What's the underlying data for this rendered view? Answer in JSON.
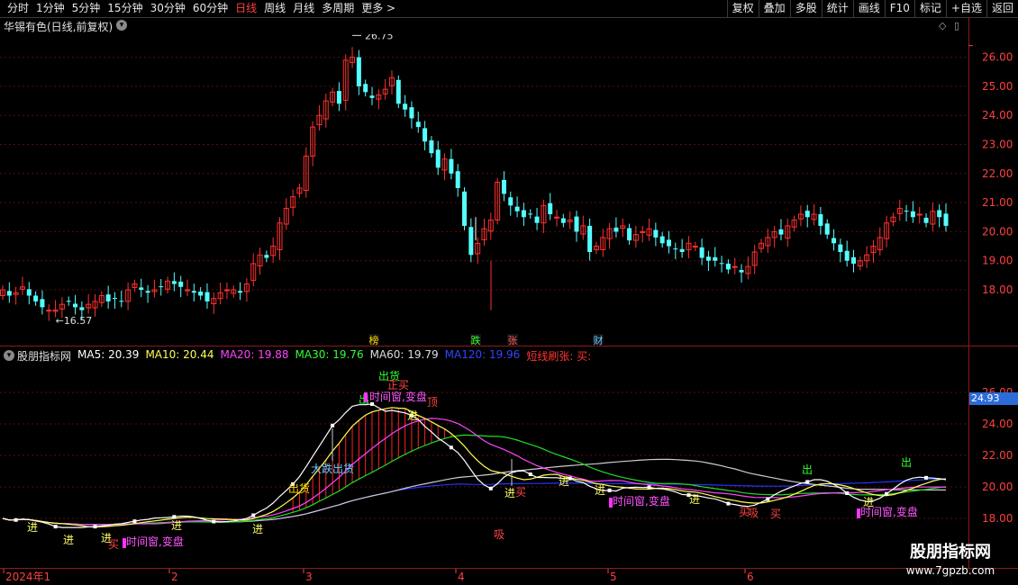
{
  "toolbar": {
    "periods": [
      "分时",
      "1分钟",
      "5分钟",
      "15分钟",
      "30分钟",
      "60分钟",
      "日线",
      "周线",
      "月线",
      "多周期",
      "更多 >"
    ],
    "active_index": 6,
    "right_buttons": [
      "复权",
      "叠加",
      "多股",
      "统计",
      "画线",
      "F10",
      "标记",
      "+自选",
      "返回"
    ]
  },
  "stock_title": "华锡有色(日线,前复权)",
  "main_chart": {
    "price_levels": [
      "26.00",
      "25.00",
      "24.00",
      "23.00",
      "22.00",
      "21.00",
      "20.00",
      "19.00",
      "18.00"
    ],
    "high_label": "26.75",
    "low_label": "16.57",
    "event_tags": [
      {
        "text": "榜",
        "color": "#ffd700"
      },
      {
        "text": "跌",
        "color": "#33ff33"
      },
      {
        "text": "张",
        "color": "#ff6060"
      },
      {
        "text": "财",
        "color": "#66ccff"
      }
    ],
    "up_color": "#ff3030",
    "down_color": "#54ffff"
  },
  "indicator": {
    "name": "股朋指标网",
    "legend": [
      {
        "text": "MA5: 20.39",
        "color": "#ffffff"
      },
      {
        "text": "MA10: 20.44",
        "color": "#ffff55"
      },
      {
        "text": "MA20: 19.88",
        "color": "#ff44ff"
      },
      {
        "text": "MA30: 19.76",
        "color": "#33ff33"
      },
      {
        "text": "MA60: 19.79",
        "color": "#dddddd"
      },
      {
        "text": "MA120: 19.96",
        "color": "#3344ff"
      },
      {
        "text": "短线刷张: 买:",
        "color": "#ff3333"
      }
    ],
    "price_levels": [
      "26.00",
      "24.00",
      "22.00",
      "20.00",
      "18.00"
    ],
    "current_price": "24.93",
    "signals": [
      {
        "text": "出货",
        "color": "#33ff33"
      },
      {
        "text": "正买",
        "color": "#ff4444"
      },
      {
        "text": "出",
        "color": "#33ff33"
      },
      {
        "text": "出",
        "color": "#33ff33"
      },
      {
        "text": "出",
        "color": "#33ff33"
      },
      {
        "text": "时间窗,变盘",
        "color": "#ff55ff"
      },
      {
        "text": "顶",
        "color": "#ff4444"
      },
      {
        "text": "大跌出货",
        "color": "#66ccff"
      },
      {
        "text": "出货",
        "color": "#ffd700"
      },
      {
        "text": "进",
        "color": "#ffff66"
      },
      {
        "text": "进",
        "color": "#ffff66"
      },
      {
        "text": "进",
        "color": "#ffff66"
      },
      {
        "text": "进",
        "color": "#ffff66"
      },
      {
        "text": "进",
        "color": "#ffff66"
      },
      {
        "text": "进",
        "color": "#ffff66"
      },
      {
        "text": "进",
        "color": "#ffff66"
      },
      {
        "text": "进",
        "color": "#ffff66"
      },
      {
        "text": "进",
        "color": "#ffff66"
      },
      {
        "text": "进",
        "color": "#ffff66"
      },
      {
        "text": "进",
        "color": "#ffff66"
      },
      {
        "text": "吸",
        "color": "#ff4444"
      },
      {
        "text": "买",
        "color": "#ff4444"
      },
      {
        "text": "买",
        "color": "#ff4444"
      },
      {
        "text": "买",
        "color": "#ff4444"
      },
      {
        "text": "买",
        "color": "#ff4444"
      },
      {
        "text": "时间窗,变盘",
        "color": "#ff55ff"
      },
      {
        "text": "时间窗,变盘",
        "color": "#ff55ff"
      },
      {
        "text": "时间窗,变盘",
        "color": "#ff55ff"
      },
      {
        "text": "吸",
        "color": "#ff4444"
      }
    ]
  },
  "date_axis": [
    "2024年1",
    "2",
    "3",
    "4",
    "5",
    "6"
  ],
  "watermark": {
    "line1": "股朋指标网",
    "line2": "www.7gpzb.com"
  }
}
